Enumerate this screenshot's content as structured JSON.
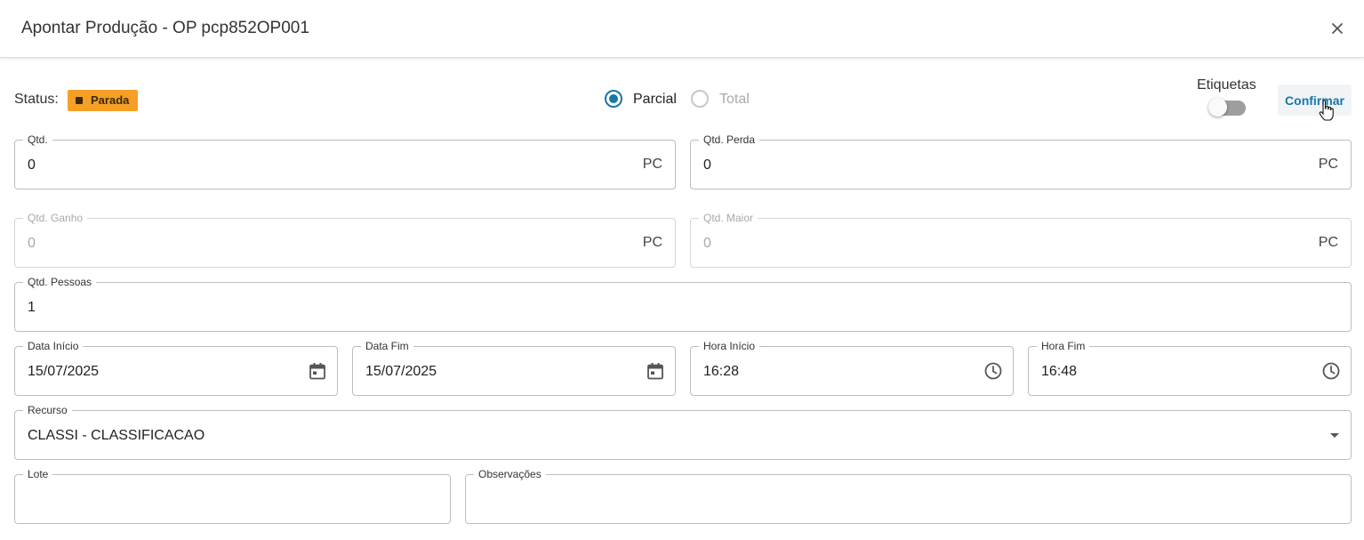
{
  "header": {
    "title": "Apontar Produção - OP pcp852OP001",
    "close_icon": "close-icon"
  },
  "status": {
    "label": "Status:",
    "badge_text": "Parada",
    "badge_color": "#f5a024"
  },
  "mode": {
    "options": [
      {
        "label": "Parcial",
        "selected": true,
        "disabled": false
      },
      {
        "label": "Total",
        "selected": false,
        "disabled": true
      }
    ]
  },
  "etiquetas": {
    "label": "Etiquetas",
    "enabled": false
  },
  "confirm_label": "Confirmar",
  "accent_color": "#1976a8",
  "fields": {
    "qtd": {
      "label": "Qtd.",
      "value": "0",
      "unit": "PC"
    },
    "qtd_perda": {
      "label": "Qtd. Perda",
      "value": "0",
      "unit": "PC"
    },
    "qtd_ganho": {
      "label": "Qtd. Ganho",
      "value": "0",
      "unit": "PC"
    },
    "qtd_maior": {
      "label": "Qtd. Maior",
      "value": "0",
      "unit": "PC"
    },
    "qtd_pessoas": {
      "label": "Qtd. Pessoas",
      "value": "1"
    },
    "data_inicio": {
      "label": "Data Início",
      "value": "15/07/2025",
      "icon": "calendar-icon"
    },
    "data_fim": {
      "label": "Data Fim",
      "value": "15/07/2025",
      "icon": "calendar-icon"
    },
    "hora_inicio": {
      "label": "Hora Início",
      "value": "16:28",
      "icon": "clock-icon"
    },
    "hora_fim": {
      "label": "Hora Fim",
      "value": "16:48",
      "icon": "clock-icon"
    },
    "recurso": {
      "label": "Recurso",
      "value": "CLASSI - CLASSIFICACAO"
    },
    "lote": {
      "label": "Lote",
      "value": ""
    },
    "observacoes": {
      "label": "Observações",
      "value": ""
    }
  }
}
